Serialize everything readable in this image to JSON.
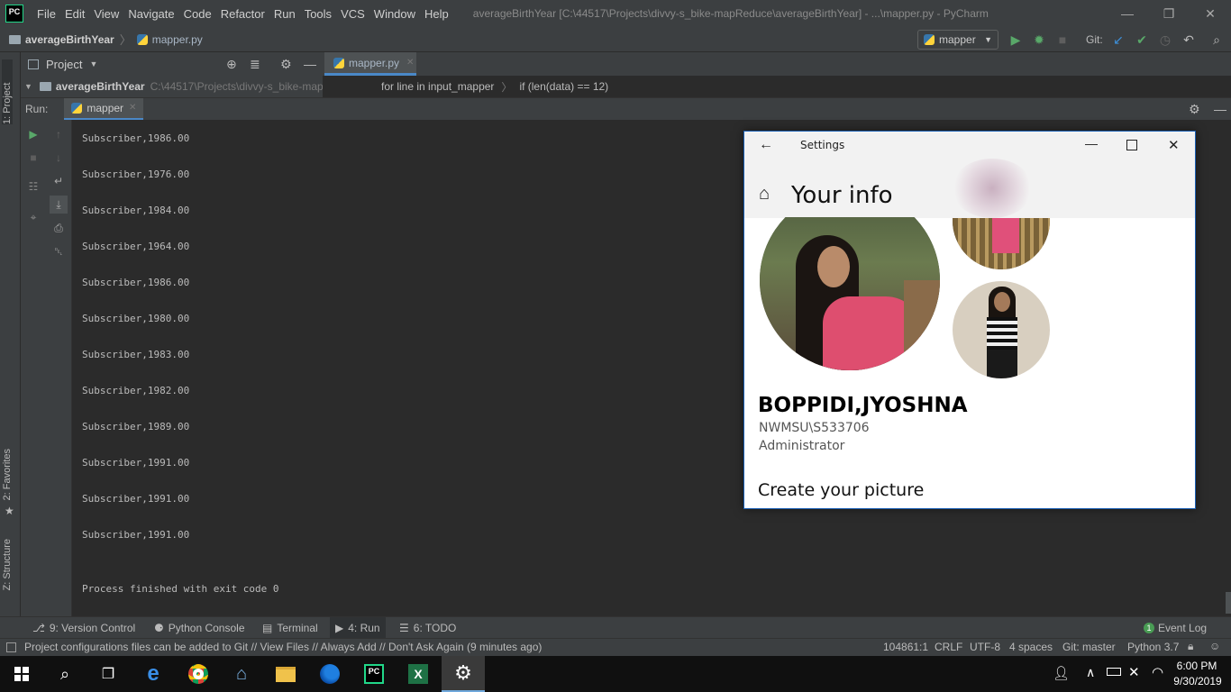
{
  "app": {
    "logo_text": "PC",
    "window_title": "averageBirthYear [C:\\44517\\Projects\\divvy-s_bike-mapReduce\\averageBirthYear] - ...\\mapper.py - PyCharm",
    "menu": [
      "File",
      "Edit",
      "View",
      "Navigate",
      "Code",
      "Refactor",
      "Run",
      "Tools",
      "VCS",
      "Window",
      "Help"
    ]
  },
  "nav": {
    "project": "averageBirthYear",
    "file": "mapper.py",
    "run_config": "mapper",
    "git_label": "Git:"
  },
  "project_panel": {
    "title": "Project",
    "root_name": "averageBirthYear",
    "root_path": "C:\\44517\\Projects\\divvy-s_bike-map"
  },
  "editor": {
    "tab": "mapper.py",
    "crumb1": "for line in input_mapper",
    "crumb2": "if (len(data) == 12)"
  },
  "run": {
    "label": "Run:",
    "tab": "mapper",
    "output": [
      "Subscriber,1986.00",
      "Subscriber,1976.00",
      "Subscriber,1984.00",
      "Subscriber,1964.00",
      "Subscriber,1986.00",
      "Subscriber,1980.00",
      "Subscriber,1983.00",
      "Subscriber,1982.00",
      "Subscriber,1989.00",
      "Subscriber,1991.00",
      "Subscriber,1991.00",
      "Subscriber,1991.00"
    ],
    "exit_message": "Process finished with exit code 0"
  },
  "side_labels": {
    "project": "1: Project",
    "favorites": "2: Favorites",
    "structure": "Z: Structure"
  },
  "bottom_tabs": {
    "version_control": "9: Version Control",
    "python_console": "Python Console",
    "terminal": "Terminal",
    "run": "4: Run",
    "todo": "6: TODO",
    "event_log": "Event Log",
    "event_count": "1"
  },
  "status": {
    "message": "Project configurations files can be added to Git // View Files // Always Add // Don't Ask Again (9 minutes ago)",
    "position": "104861:1",
    "line_sep": "CRLF",
    "encoding": "UTF-8",
    "indent": "4 spaces",
    "branch": "Git: master",
    "interpreter": "Python 3.7"
  },
  "settings": {
    "window_title": "Settings",
    "page_title": "Your info",
    "user_name": "BOPPIDI,JYOSHNA",
    "account": "NWMSU\\S533706",
    "role": "Administrator",
    "section": "Create your picture"
  },
  "taskbar": {
    "time": "6:00 PM",
    "date": "9/30/2019"
  }
}
